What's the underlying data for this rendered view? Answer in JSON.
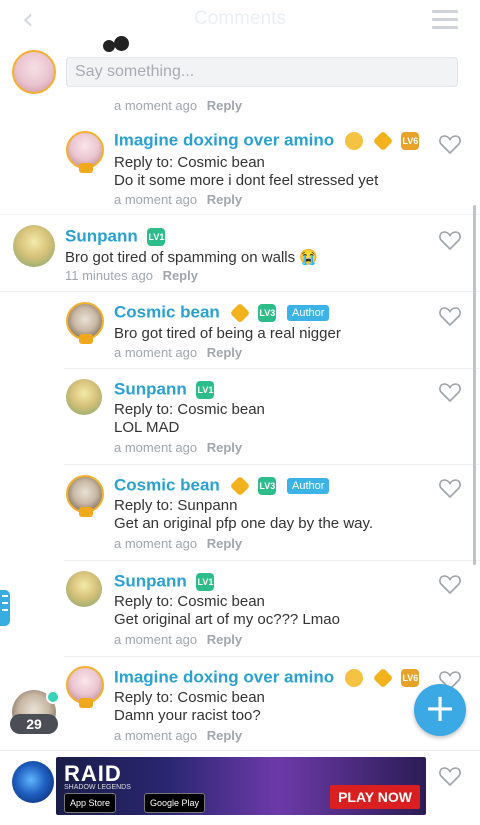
{
  "header": {
    "title": "Comments"
  },
  "compose": {
    "placeholder": "Say something..."
  },
  "top_partial": {
    "time": "a moment ago",
    "reply": "Reply"
  },
  "comments": [
    {
      "name": "Imagine doxing over amino",
      "reply_to": "Reply to: Cosmic bean",
      "text": "Do it some more i dont feel stressed yet",
      "time": "a moment ago",
      "reply": "Reply",
      "level": "LV6"
    },
    {
      "name": "Sunpann",
      "text": "Bro got tired of spamming on walls 😭",
      "time": "11 minutes ago",
      "reply": "Reply",
      "level": "LV1"
    },
    {
      "name": "Cosmic bean",
      "author": "Author",
      "text": "Bro got tired of being a real nigger",
      "time": "a moment ago",
      "reply": "Reply",
      "level": "LV3"
    },
    {
      "name": "Sunpann",
      "reply_to": "Reply to: Cosmic bean",
      "text": "LOL MAD",
      "time": "a moment ago",
      "reply": "Reply",
      "level": "LV1"
    },
    {
      "name": "Cosmic bean",
      "author": "Author",
      "reply_to": "Reply to: Sunpann",
      "text": "Get an original pfp one day by the way.",
      "time": "a moment ago",
      "reply": "Reply",
      "level": "LV3"
    },
    {
      "name": "Sunpann",
      "reply_to": "Reply to: Cosmic bean",
      "text": "Get original art of my oc??? Lmao",
      "time": "a moment ago",
      "reply": "Reply",
      "level": "LV1"
    },
    {
      "name": "Imagine doxing over amino",
      "reply_to": "Reply to: Cosmic bean",
      "text": "Damn your racist too?",
      "time": "a moment ago",
      "reply": "Reply",
      "level": "LV6"
    }
  ],
  "online": {
    "count": "29"
  },
  "ad": {
    "headline": "RAID",
    "subline": "SHADOW LEGENDS",
    "app_store": "App Store",
    "google_play": "Google Play",
    "cta": "PLAY NOW"
  },
  "colors": {
    "accent": "#2aa1d3",
    "author_badge": "#3bb3e6",
    "fab": "#3aa9e4",
    "level_badge": "#2dbd8a",
    "gold_frame": "#f3b12e"
  },
  "icons": {
    "back": "chevron-left-icon",
    "menu": "menu-icon",
    "heart": "heart-outline-icon",
    "plus": "plus-icon",
    "side": "list-icon"
  }
}
